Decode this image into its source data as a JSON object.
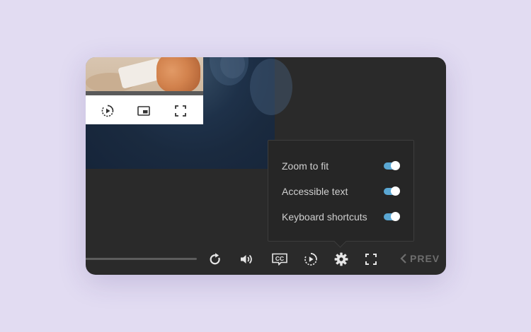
{
  "settings": {
    "items": [
      {
        "label": "Zoom to fit",
        "enabled": true
      },
      {
        "label": "Accessible text",
        "enabled": true
      },
      {
        "label": "Keyboard shortcuts",
        "enabled": true
      }
    ]
  },
  "controls": {
    "prev_label": "PREV",
    "cc_label": "CC",
    "icons": [
      "replay-icon",
      "volume-icon",
      "closed-captions-icon",
      "playback-speed-icon",
      "settings-gear-icon",
      "fullscreen-icon",
      "chevron-left-icon"
    ]
  },
  "mini_player": {
    "icons": [
      "playback-speed-icon",
      "picture-in-picture-icon",
      "fullscreen-icon"
    ]
  },
  "colors": {
    "background": "#e2dcf2",
    "player": "#2a2a2a",
    "toggle_on": "#5aa7d3",
    "text": "#cfcfcf",
    "icon": "#e6e6e6",
    "muted": "#6e6e6e"
  }
}
